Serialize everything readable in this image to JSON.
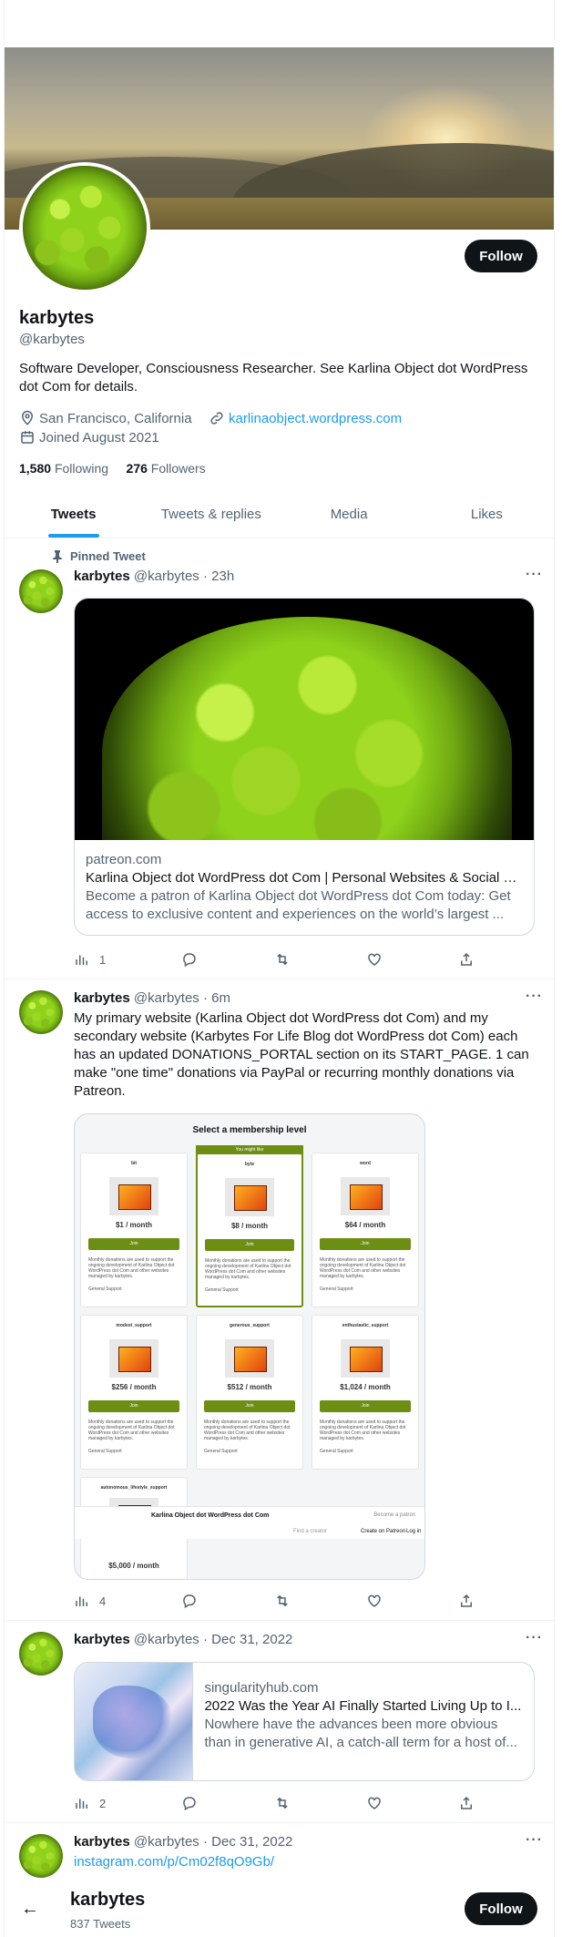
{
  "profile": {
    "name": "karbytes",
    "handle": "@karbytes",
    "bio": "Software Developer, Consciousness Researcher. See Karlina Object dot WordPress dot Com for details.",
    "location": "San Francisco, California",
    "website": "karlinaobject.wordpress.com",
    "joined": "Joined August 2021",
    "following_count": "1,580",
    "following_label": "Following",
    "followers_count": "276",
    "followers_label": "Followers",
    "follow_label": "Follow"
  },
  "tabs": [
    "Tweets",
    "Tweets & replies",
    "Media",
    "Likes"
  ],
  "tweets": [
    {
      "pinned_label": "Pinned Tweet",
      "name": "karbytes",
      "handle": "@karbytes",
      "time": "· 23h",
      "card": {
        "domain": "patreon.com",
        "title": "Karlina Object dot WordPress dot Com | Personal Websites & Social M...",
        "description": "Become a patron of Karlina Object dot WordPress dot Com today: Get access to exclusive content and experiences on the world’s largest ..."
      },
      "views": "1",
      "replies": "",
      "retweets": "",
      "likes": ""
    },
    {
      "name": "karbytes",
      "handle": "@karbytes",
      "time": "· 6m",
      "text": "My primary website (Karlina Object dot WordPress dot Com) and my secondary website (Karbytes For Life Blog dot WordPress dot Com) each has an updated DONATIONS_PORTAL section on its START_PAGE. 1 can make \"one time\" donations via PayPal or recurring monthly donations via Patreon.",
      "shot": {
        "title": "Select a membership level",
        "favorite_label": "You might like",
        "join_label": "Join",
        "tiers": [
          {
            "name": "bit",
            "price": "$1 / month"
          },
          {
            "name": "byte",
            "price": "$8 / month"
          },
          {
            "name": "word",
            "price": "$64 / month"
          },
          {
            "name": "modest_support",
            "price": "$256 / month"
          },
          {
            "name": "generous_support",
            "price": "$512 / month"
          },
          {
            "name": "enthusiastic_support",
            "price": "$1,024 / month"
          },
          {
            "name": "autonomous_lifestyle_support",
            "price": "$5,000 / month"
          }
        ],
        "tier_description": "Monthly donations are used to support the ongoing development of Karlina Object dot WordPress dot Com and other websites managed by karbytes.",
        "tier_benefit": "General Support",
        "footer_name": "Karlina Object dot WordPress dot Com",
        "footer_become": "Become a patron",
        "footer_search": "Find a creator",
        "footer_create": "Create on Patreon",
        "footer_login": "Log in"
      },
      "views": "4",
      "replies": "",
      "retweets": "",
      "likes": ""
    },
    {
      "name": "karbytes",
      "handle": "@karbytes",
      "time": "· Dec 31, 2022",
      "card": {
        "domain": "singularityhub.com",
        "title": "2022 Was the Year AI Finally Started Living Up to I...",
        "description": "Nowhere have the advances been more obvious than in generative AI, a catch-all term for a host of..."
      },
      "views": "2",
      "replies": "",
      "retweets": "",
      "likes": ""
    },
    {
      "name": "karbytes",
      "handle": "@karbytes",
      "time": "· Dec 31, 2022",
      "link": "instagram.com/p/Cm02f8qO9Gb/"
    }
  ],
  "bottom_bar": {
    "name": "karbytes",
    "count": "837 Tweets",
    "follow_label": "Follow"
  },
  "colors": {
    "accent": "#1d9bf0",
    "text": "#0f1419",
    "muted": "#536471",
    "border": "#eff3f4",
    "patreon_green": "#6c8e13"
  },
  "icons": [
    "pin-icon",
    "location-icon",
    "link-icon",
    "calendar-icon",
    "views-icon",
    "reply-icon",
    "retweet-icon",
    "like-icon",
    "share-icon",
    "more-icon",
    "back-arrow-icon"
  ]
}
